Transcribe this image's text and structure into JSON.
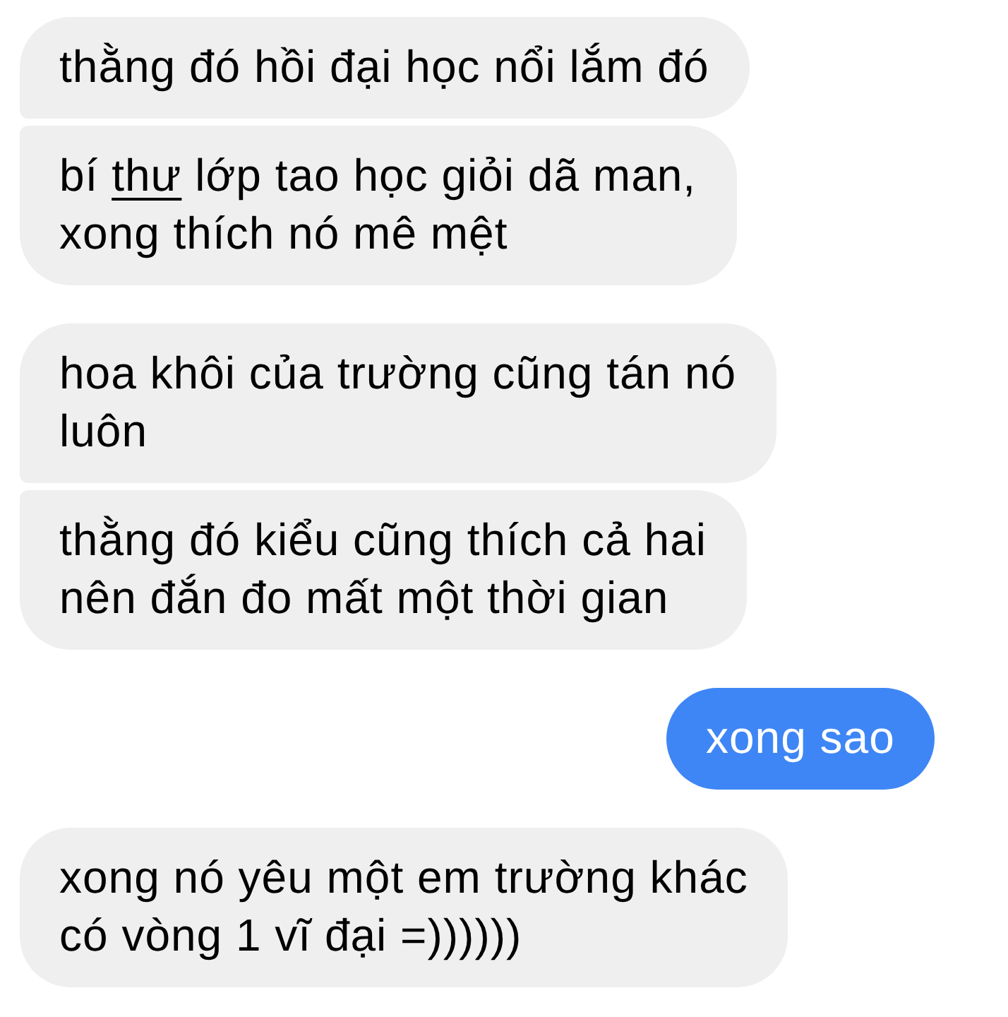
{
  "groups": [
    {
      "kind": "incoming",
      "messages": [
        {
          "text": "thằng đó hồi đại học nổi lắm đó"
        },
        {
          "parts": [
            {
              "text": "bí ",
              "underlined": false
            },
            {
              "text": "thư",
              "underlined": true
            },
            {
              "text": " lớp tao học giỏi dã man, xong thích nó mê mệt",
              "underlined": false
            }
          ]
        }
      ]
    },
    {
      "kind": "incoming",
      "messages": [
        {
          "text": "hoa khôi của trường cũng tán nó luôn"
        },
        {
          "text": "thằng đó kiểu cũng thích cả hai nên đắn đo mất một thời gian"
        }
      ]
    },
    {
      "kind": "outgoing",
      "messages": [
        {
          "text": "xong sao"
        }
      ]
    },
    {
      "kind": "incoming",
      "messages": [
        {
          "text": "xong nó yêu một em trường khác có vòng 1 vĩ đại =))))))"
        }
      ]
    }
  ]
}
